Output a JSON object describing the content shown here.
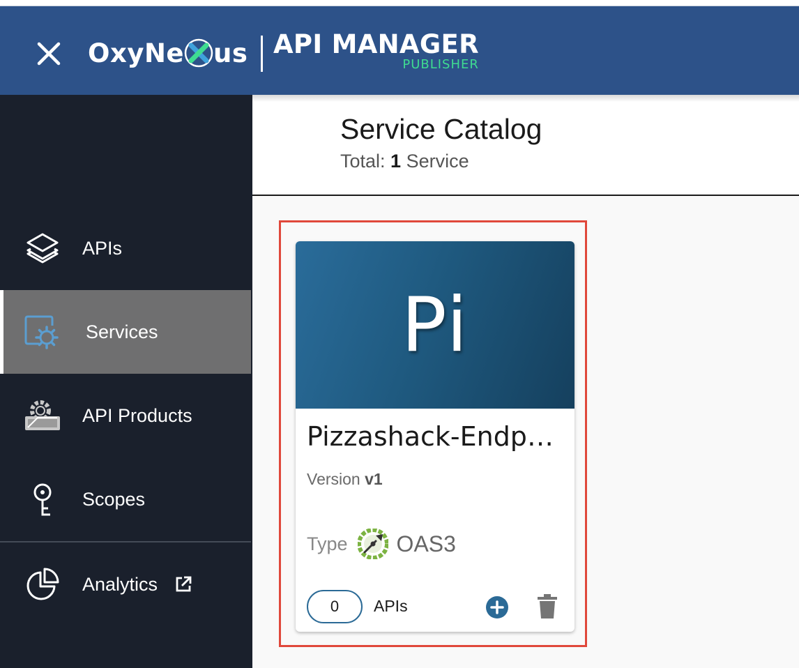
{
  "header": {
    "brand": {
      "before": "OxyNe",
      "after": "us"
    },
    "product": "API MANAGER",
    "product_sub": "PUBLISHER",
    "colors": {
      "bar": "#2d5289",
      "accent": "#3fdc91"
    }
  },
  "sidebar": {
    "items": [
      {
        "label": "APIs",
        "icon": "layers-icon"
      },
      {
        "label": "Services",
        "icon": "services-gear-icon",
        "active": true
      },
      {
        "label": "API Products",
        "icon": "api-products-icon"
      },
      {
        "label": "Scopes",
        "icon": "key-icon"
      },
      {
        "label": "Analytics",
        "icon": "pie-chart-icon",
        "external": true
      }
    ]
  },
  "main": {
    "title": "Service Catalog",
    "total": {
      "prefix": "Total: ",
      "count": "1",
      "suffix": " Service"
    }
  },
  "card": {
    "thumb_text": "Pi",
    "name": "Pizzashack-Endpoint",
    "version_label": "Version ",
    "version": "v1",
    "type_label": "Type",
    "type_value": "OAS3",
    "api_count": "0",
    "api_label": "APIs"
  }
}
